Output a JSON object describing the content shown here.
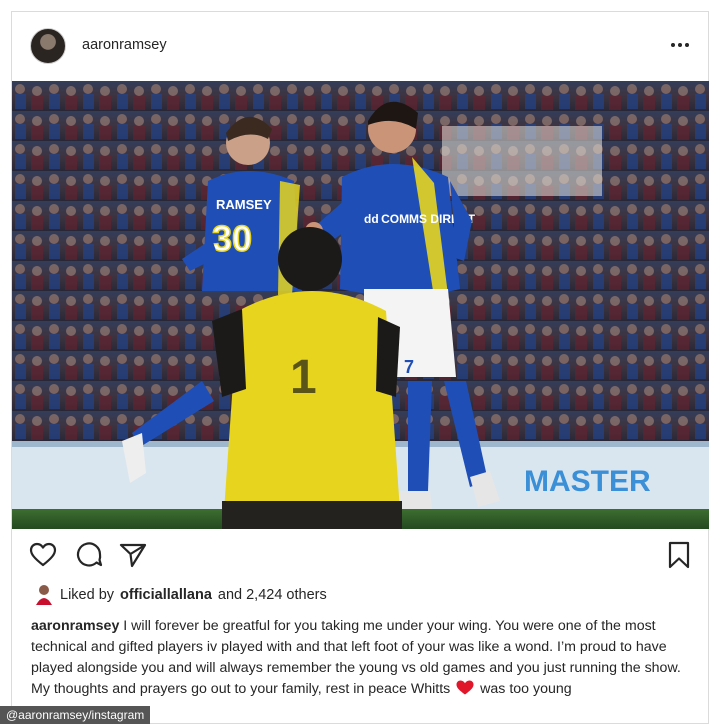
{
  "header": {
    "username": "aaronramsey",
    "avatar_icon": "profile-avatar",
    "more_icon": "more-options-icon"
  },
  "photo": {
    "description_icon": "football-celebration-photo",
    "ramsey_shirt_name": "RAMSEY",
    "ramsey_shirt_number": "30",
    "goalkeeper_shirt_number": "1",
    "sponsor_text": "dd COMMS DIRECT",
    "shorts_number": "7",
    "hoarding_text": "MASTER",
    "colors": {
      "kit_blue": "#1f4fb6",
      "kit_yellow": "#e6d41f",
      "grass": "#2f5e2a"
    }
  },
  "actions": {
    "like_icon": "heart-icon",
    "comment_icon": "comment-icon",
    "share_icon": "send-icon",
    "save_icon": "bookmark-icon"
  },
  "likes": {
    "prefix": "Liked by",
    "liker": "officiallallana",
    "suffix": "and 2,424 others"
  },
  "caption": {
    "username": "aaronramsey",
    "text_before_heart": "I will forever be greatful for you taking me under your wing. You were one of the most technical and gifted players iv played with and that left foot of your was like a wond. I’m proud to have played alongside you and will always remember the young vs old games and you just running the show. My thoughts and prayers go out to your family, rest in peace Whitts",
    "text_after_heart": "was too young"
  },
  "credit": "@aaronramsey/instagram"
}
